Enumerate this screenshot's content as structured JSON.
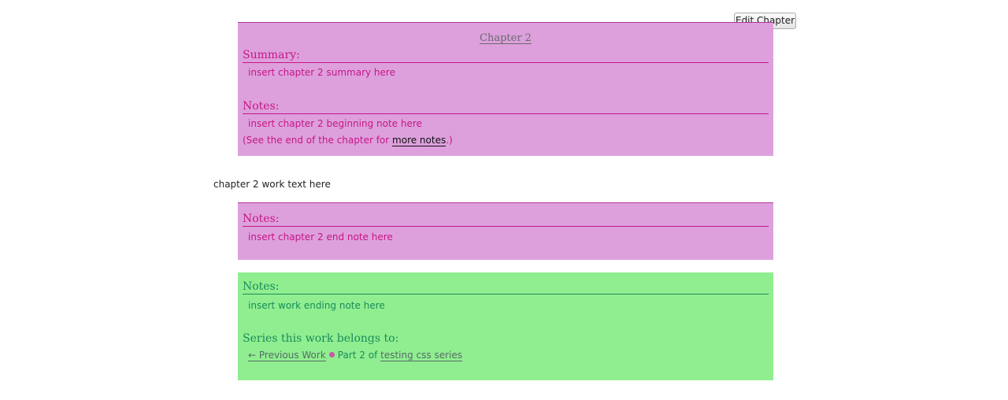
{
  "toolbar": {
    "edit_label": "Edit Chapter"
  },
  "chapter": {
    "title": "Chapter 2",
    "summary_heading": "Summary:",
    "summary_text": "insert chapter 2 summary here",
    "notes_heading": "Notes:",
    "begin_note": "insert chapter 2 beginning note here",
    "see_end_prefix": "(See the end of the chapter for ",
    "more_notes_link": "more notes",
    "see_end_suffix": ".)"
  },
  "work": {
    "text": "chapter 2 work text here"
  },
  "end_notes": {
    "heading": "Notes:",
    "text": "insert chapter 2 end note here"
  },
  "work_end": {
    "notes_heading": "Notes:",
    "notes_text": "insert work ending note here",
    "series_heading": "Series this work belongs to:",
    "prev_link": "← Previous Work",
    "part_text": "Part 2 of ",
    "series_link": "testing css series"
  },
  "colors": {
    "pink_bg": "#dda0dd",
    "pink_text": "#c71585",
    "green_bg": "#90ee90",
    "green_text": "#1a8c5a"
  }
}
